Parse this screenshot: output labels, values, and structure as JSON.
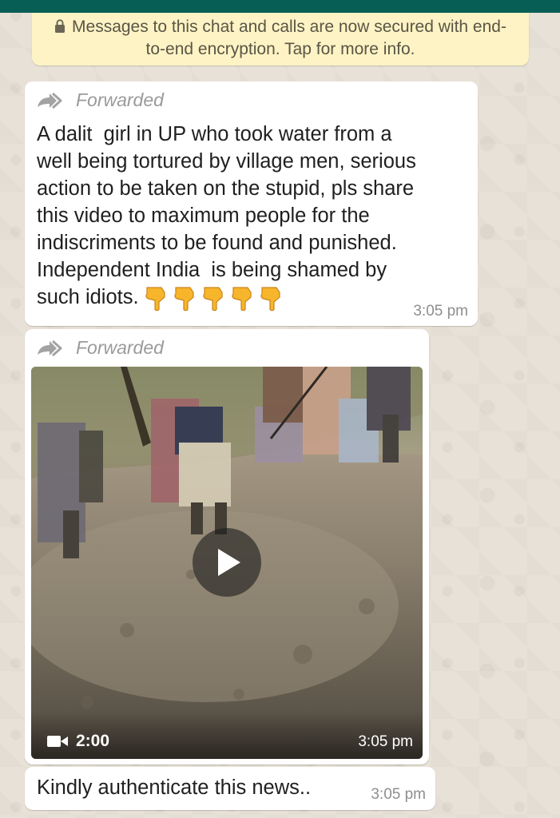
{
  "encryption_notice": "Messages to this chat and calls are now secured with end-to-end encryption. Tap for more info.",
  "messages": [
    {
      "forwarded_label": "Forwarded",
      "text": "A dalit  girl in UP who took water from a\nwell being tortured by village men, serious\naction to be taken on the stupid, pls share\nthis video to maximum people for the\nindiscriments to be found and punished.\nIndependent India  is being shamed by\nsuch idiots.",
      "emoji_count": 5,
      "emoji": "backhand-index-pointing-down",
      "time": "3:05 pm"
    },
    {
      "forwarded_label": "Forwarded",
      "video_duration": "2:00",
      "time": "3:05 pm"
    },
    {
      "text": "Kindly authenticate this news..",
      "time": "3:05 pm"
    }
  ],
  "icons": {
    "lock": "lock-icon",
    "forward": "forward-icon",
    "play": "play-icon",
    "video_camera": "video-camera-icon",
    "pointing_down": "pointing-down-emoji"
  },
  "colors": {
    "header": "#075e54",
    "notice_bg": "#fdf3c4",
    "bubble_bg": "#ffffff",
    "wallpaper": "#e8e1d7"
  }
}
